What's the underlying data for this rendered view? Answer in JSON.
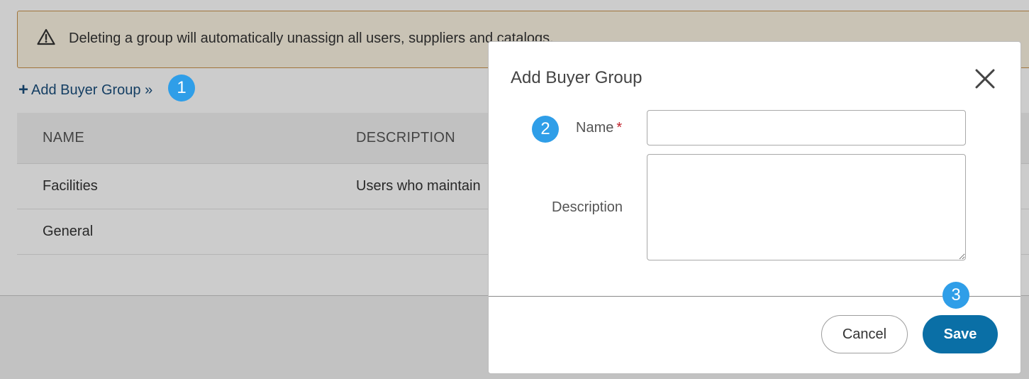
{
  "alert": {
    "message": "Deleting a group will automatically unassign all users, suppliers and catalogs.",
    "icon": "warning-triangle-icon"
  },
  "add_link": {
    "label": "Add Buyer Group »",
    "icon": "plus-icon"
  },
  "table": {
    "headers": [
      "NAME",
      "DESCRIPTION"
    ],
    "rows": [
      {
        "name": "Facilities",
        "description": "Users who maintain"
      },
      {
        "name": "General",
        "description": ""
      }
    ]
  },
  "modal": {
    "title": "Add Buyer Group",
    "name_label": "Name",
    "required_marker": "*",
    "name_value": "",
    "description_label": "Description",
    "description_value": "",
    "cancel_label": "Cancel",
    "save_label": "Save"
  },
  "callouts": [
    "1",
    "2",
    "3"
  ],
  "colors": {
    "link": "#1a4e7c",
    "callout": "#2f9ee8",
    "save_button": "#0a6fa6",
    "alert_background": "#fcf4e3",
    "alert_border": "#c9924a",
    "required": "#c0212b"
  }
}
